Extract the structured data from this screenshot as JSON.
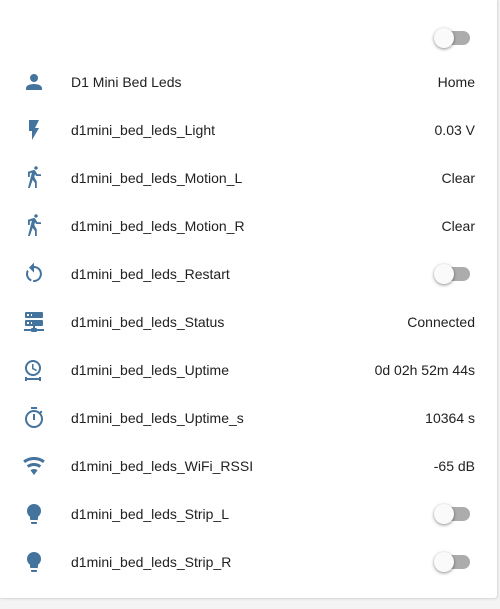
{
  "header": {
    "toggle_state": "off"
  },
  "colors": {
    "icon": "#44739e",
    "text": "#212121",
    "toggle_off_track": "#9e9e9e",
    "toggle_off_knob": "#fafafa"
  },
  "entities": [
    {
      "icon": "account-icon",
      "name": "D1 Mini Bed Leds",
      "state": "Home",
      "type": "text"
    },
    {
      "icon": "flash-icon",
      "name": "d1mini_bed_leds_Light",
      "state": "0.03 V",
      "type": "text"
    },
    {
      "icon": "walk-icon",
      "name": "d1mini_bed_leds_Motion_L",
      "state": "Clear",
      "type": "text"
    },
    {
      "icon": "walk-icon",
      "name": "d1mini_bed_leds_Motion_R",
      "state": "Clear",
      "type": "text"
    },
    {
      "icon": "restart-icon",
      "name": "d1mini_bed_leds_Restart",
      "state": "off",
      "type": "toggle"
    },
    {
      "icon": "server-network-icon",
      "name": "d1mini_bed_leds_Status",
      "state": "Connected",
      "type": "text"
    },
    {
      "icon": "clock-timeline-icon",
      "name": "d1mini_bed_leds_Uptime",
      "state": "0d 02h 52m 44s",
      "type": "text"
    },
    {
      "icon": "timer-icon",
      "name": "d1mini_bed_leds_Uptime_s",
      "state": "10364 s",
      "type": "text"
    },
    {
      "icon": "wifi-icon",
      "name": "d1mini_bed_leds_WiFi_RSSI",
      "state": "-65 dB",
      "type": "text"
    },
    {
      "icon": "lightbulb-icon",
      "name": "d1mini_bed_leds_Strip_L",
      "state": "off",
      "type": "toggle"
    },
    {
      "icon": "lightbulb-icon",
      "name": "d1mini_bed_leds_Strip_R",
      "state": "off",
      "type": "toggle"
    }
  ]
}
